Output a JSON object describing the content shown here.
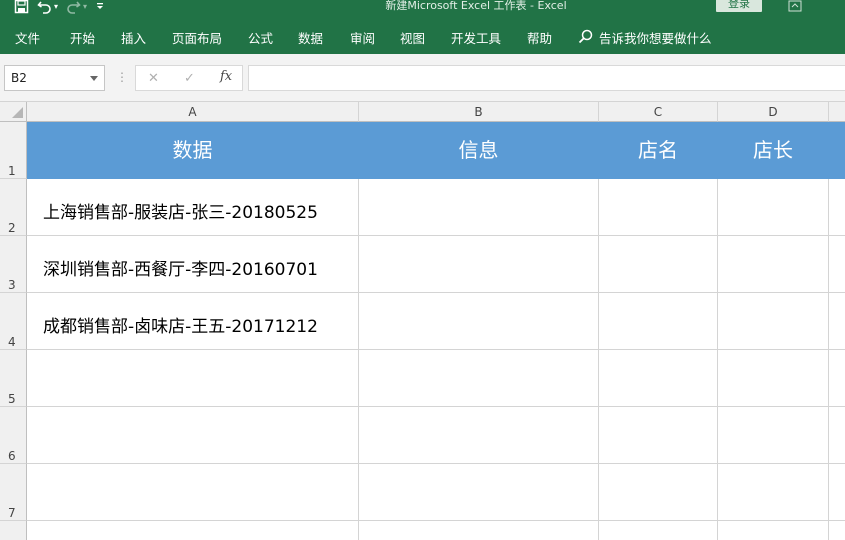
{
  "window": {
    "title": "新建Microsoft Excel 工作表  -  Excel",
    "login_label": "登录"
  },
  "qat_icons": [
    "save-icon",
    "undo-icon",
    "redo-icon",
    "customize-icon"
  ],
  "ribbon": {
    "tabs": [
      "文件",
      "开始",
      "插入",
      "页面布局",
      "公式",
      "数据",
      "审阅",
      "视图",
      "开发工具",
      "帮助"
    ],
    "tell_me": "告诉我你想要做什么"
  },
  "formula_bar": {
    "name_box": "B2",
    "cancel_glyph": "✕",
    "enter_glyph": "✓",
    "fx_label": "fx",
    "formula_value": ""
  },
  "columns": [
    "A",
    "B",
    "C",
    "D"
  ],
  "rows": [
    "1",
    "2",
    "3",
    "4",
    "5",
    "6",
    "7"
  ],
  "header_row": [
    "数据",
    "信息",
    "店名",
    "店长"
  ],
  "data_rows": [
    [
      "上海销售部-服装店-张三-20180525",
      "",
      "",
      ""
    ],
    [
      "深圳销售部-西餐厅-李四-20160701",
      "",
      "",
      ""
    ],
    [
      "成都销售部-卤味店-王五-20171212",
      "",
      "",
      ""
    ]
  ],
  "colors": {
    "ribbon_green": "#217346",
    "header_fill": "#5b9bd5"
  }
}
